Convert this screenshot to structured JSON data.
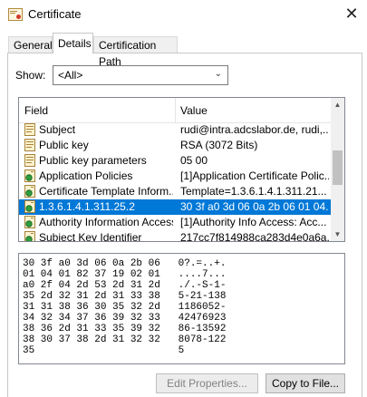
{
  "window": {
    "title": "Certificate",
    "icon": "certificate-icon",
    "close_glyph": "✕"
  },
  "tabs": [
    {
      "label": "General"
    },
    {
      "label": "Details"
    },
    {
      "label": "Certification Path"
    }
  ],
  "show": {
    "label": "Show:",
    "value": "<All>",
    "chevron": "⌄"
  },
  "list": {
    "headers": {
      "field": "Field",
      "value": "Value"
    },
    "rows": [
      {
        "field": "Subject",
        "value": "rudi@intra.adcslabor.de, rudi,...",
        "icon": "document-field-icon"
      },
      {
        "field": "Public key",
        "value": "RSA (3072 Bits)",
        "icon": "document-field-icon"
      },
      {
        "field": "Public key parameters",
        "value": "05 00",
        "icon": "document-field-icon"
      },
      {
        "field": "Application Policies",
        "value": "[1]Application Certificate Polic...",
        "icon": "extension-field-icon"
      },
      {
        "field": "Certificate Template Inform...",
        "value": "Template=1.3.6.1.4.1.311.21...",
        "icon": "extension-field-icon"
      },
      {
        "field": "1.3.6.1.4.1.311.25.2",
        "value": "30 3f a0 3d 06 0a 2b 06 01 04...",
        "icon": "extension-field-icon"
      },
      {
        "field": "Authority Information Access",
        "value": "[1]Authority Info Access: Acc...",
        "icon": "extension-field-icon"
      },
      {
        "field": "Subject Key Identifier",
        "value": "217cc7f814988ca283d4e0a6a...",
        "icon": "extension-field-icon"
      }
    ],
    "selected_index": 5
  },
  "hex_lines": [
    "30 3f a0 3d 06 0a 2b 06   0?.=..+.",
    "01 04 01 82 37 19 02 01   ....7...",
    "a0 2f 04 2d 53 2d 31 2d   ./.-S-1-",
    "35 2d 32 31 2d 31 33 38   5-21-138",
    "31 31 38 36 30 35 32 2d   1186052-",
    "34 32 34 37 36 39 32 33   42476923",
    "38 36 2d 31 33 35 39 32   86-13592",
    "38 30 37 38 2d 31 32 32   8078-122",
    "35                        5"
  ],
  "buttons": {
    "edit_properties": "Edit Properties...",
    "copy_to_file": "Copy to File..."
  }
}
